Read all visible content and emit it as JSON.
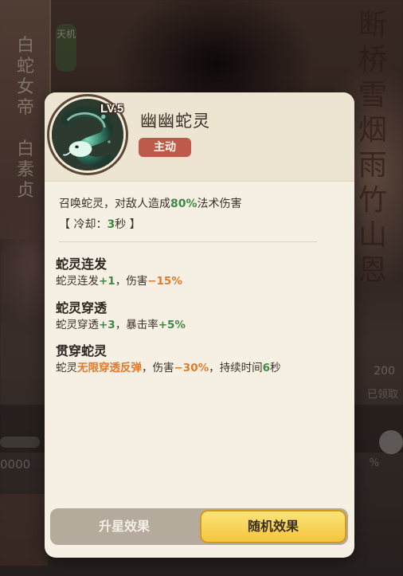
{
  "background": {
    "left_card_name": "白蛇女帝",
    "left_card_subname": "白素贞",
    "left_tag": "天机",
    "right_poem": "断桥雪烟雨竹山恩",
    "right_count": "200",
    "right_claim": "已领取",
    "left_number": "0000",
    "right_percent": "%"
  },
  "skill": {
    "level": "LV.5",
    "name": "幽幽蛇灵",
    "type": "主动",
    "description": {
      "prefix": "召唤蛇灵，对敌人造成",
      "value": "80%",
      "suffix": "法术伤害"
    },
    "cooldown": {
      "prefix": "【 冷却：",
      "value": "3",
      "suffix": "秒 】"
    }
  },
  "effects": [
    {
      "title": "蛇灵连发",
      "parts": [
        {
          "text": "蛇灵连发",
          "style": ""
        },
        {
          "text": "+1",
          "style": "green"
        },
        {
          "text": "，伤害",
          "style": ""
        },
        {
          "text": "−15%",
          "style": "orange"
        }
      ]
    },
    {
      "title": "蛇灵穿透",
      "parts": [
        {
          "text": "蛇灵穿透",
          "style": ""
        },
        {
          "text": "+3",
          "style": "green"
        },
        {
          "text": "，暴击率",
          "style": ""
        },
        {
          "text": "+5%",
          "style": "green"
        }
      ]
    },
    {
      "title": "贯穿蛇灵",
      "parts": [
        {
          "text": "蛇灵",
          "style": ""
        },
        {
          "text": "无限穿透反弹",
          "style": "orange"
        },
        {
          "text": "，伤害",
          "style": ""
        },
        {
          "text": "−30%",
          "style": "orange"
        },
        {
          "text": "，持续时间",
          "style": ""
        },
        {
          "text": "6",
          "style": "green"
        },
        {
          "text": "秒",
          "style": ""
        }
      ]
    }
  ],
  "tabs": {
    "star_upgrade": "升星效果",
    "random_effect": "随机效果",
    "active": "random_effect"
  },
  "colors": {
    "popup_bg": "#f6f0e4",
    "header_bg": "#ede4d2",
    "type_badge": "#bd5a4a",
    "positive": "#3d8a44",
    "negative": "#e07a2c",
    "active_tab": "#f4c53d",
    "inactive_tab": "#b5ab9d"
  },
  "icons": {
    "skill": "green-serpent-icon"
  }
}
